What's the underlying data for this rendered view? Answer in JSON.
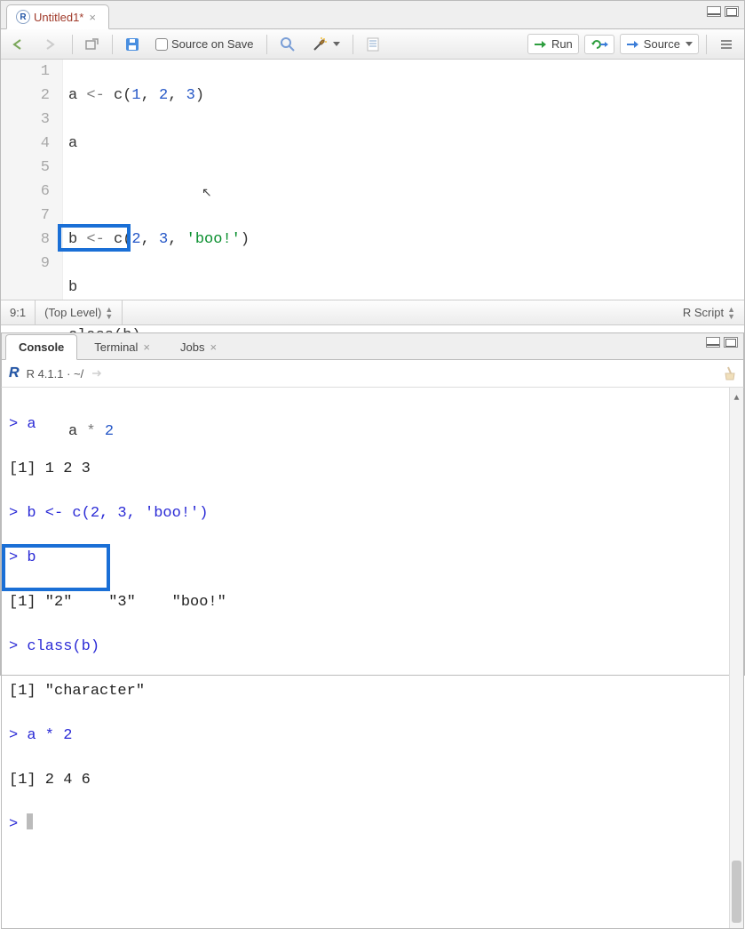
{
  "source": {
    "tab": {
      "title": "Untitled1*"
    },
    "toolbar": {
      "source_on_save": "Source on Save",
      "run": "Run",
      "source": "Source"
    },
    "lines": {
      "l1": {
        "pre": "a ",
        "op1": "<-",
        "mid": " c(",
        "n1": "1",
        "c1": ", ",
        "n2": "2",
        "c2": ", ",
        "n3": "3",
        "post": ")"
      },
      "l2": "a",
      "l4": {
        "pre": "b ",
        "op1": "<-",
        "mid": " c(",
        "n1": "2",
        "c1": ", ",
        "n2": "3",
        "c2": ", ",
        "s1": "'boo!'",
        "post": ")"
      },
      "l5": "b",
      "l6": {
        "fn": "class",
        "arg": "(b)"
      },
      "l8": {
        "a": "a ",
        "op": "* ",
        "n": "2"
      }
    },
    "status": {
      "pos": "9:1",
      "scope": "(Top Level)",
      "lang": "R Script"
    }
  },
  "console": {
    "tabs": {
      "console": "Console",
      "terminal": "Terminal",
      "jobs": "Jobs"
    },
    "version": "R 4.1.1 · ~/",
    "out": {
      "l1": "> a",
      "l2": "[1] 1 2 3",
      "l3": "> b <- c(2, 3, 'boo!')",
      "l4": "> b",
      "l5": "[1] \"2\"    \"3\"    \"boo!\"",
      "l6": "> class(b)",
      "l7": "[1] \"character\"",
      "l8": "> a * 2",
      "l9": "[1] 2 4 6",
      "l10": "> "
    }
  }
}
